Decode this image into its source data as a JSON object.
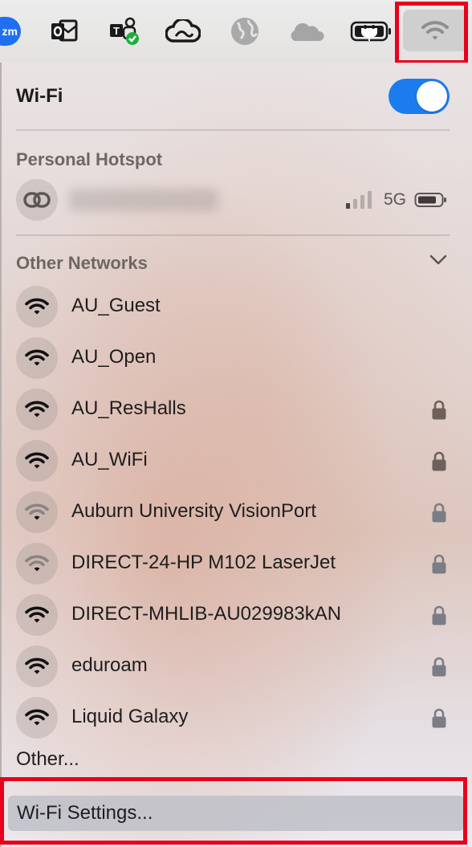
{
  "menubar": {
    "icons": [
      {
        "name": "zoom-icon",
        "label": "zm"
      },
      {
        "name": "outlook-icon"
      },
      {
        "name": "teams-icon"
      },
      {
        "name": "creative-cloud-icon"
      },
      {
        "name": "globe-icon"
      },
      {
        "name": "onedrive-icon"
      },
      {
        "name": "battery-charging-icon"
      },
      {
        "name": "wifi-status-icon"
      }
    ],
    "highlight_color": "#e8001c"
  },
  "panel": {
    "title": "Wi-Fi",
    "toggle_on": true,
    "accent_color": "#1b7cf0",
    "personal_hotspot": {
      "section_label": "Personal Hotspot",
      "device_name_blurred": true,
      "network_type": "5G",
      "signal_bars_filled": 1,
      "signal_bars_total": 4
    },
    "other_networks": {
      "section_label": "Other Networks",
      "expanded": true,
      "networks": [
        {
          "name": "AU_Guest",
          "locked": false,
          "strength": "strong"
        },
        {
          "name": "AU_Open",
          "locked": false,
          "strength": "strong"
        },
        {
          "name": "AU_ResHalls",
          "locked": true,
          "strength": "strong"
        },
        {
          "name": "AU_WiFi",
          "locked": true,
          "strength": "strong"
        },
        {
          "name": "Auburn University VisionPort",
          "locked": true,
          "strength": "weak"
        },
        {
          "name": "DIRECT-24-HP M102 LaserJet",
          "locked": true,
          "strength": "weak"
        },
        {
          "name": "DIRECT-MHLIB-AU029983kAN",
          "locked": true,
          "strength": "strong"
        },
        {
          "name": "eduroam",
          "locked": true,
          "strength": "strong"
        },
        {
          "name": "Liquid Galaxy",
          "locked": true,
          "strength": "strong"
        }
      ]
    },
    "other_label": "Other...",
    "settings_label": "Wi-Fi Settings..."
  }
}
